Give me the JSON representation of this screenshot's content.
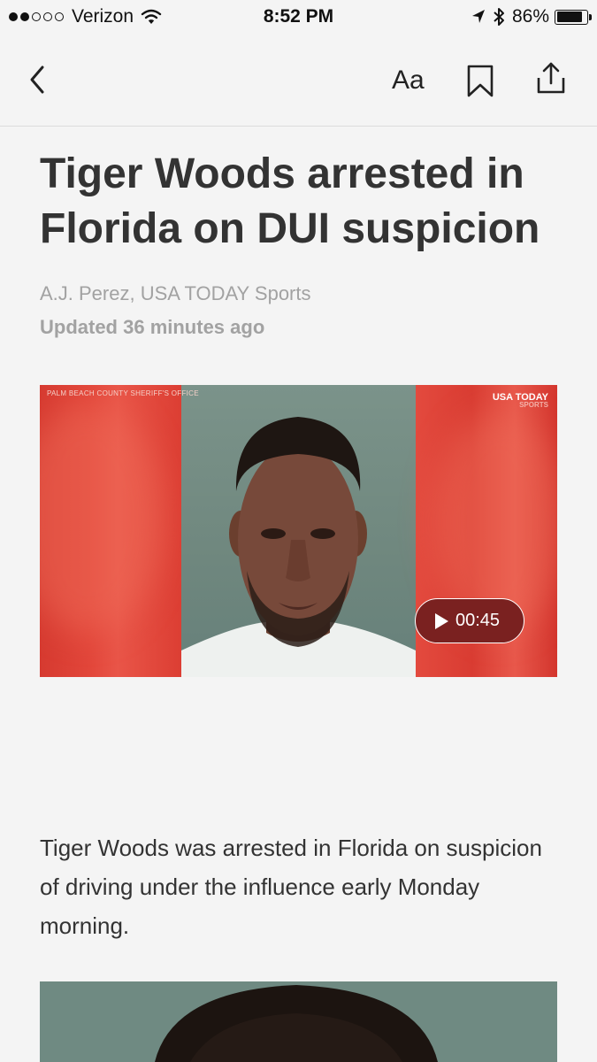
{
  "status_bar": {
    "carrier": "Verizon",
    "signal_bars_filled": 2,
    "signal_bars_total": 5,
    "time": "8:52 PM",
    "battery": "86%",
    "battery_level": 0.86
  },
  "nav": {
    "font_size_label": "Aa"
  },
  "article": {
    "headline": "Tiger Woods arrested in Florida on DUI suspicion",
    "byline": "A.J. Perez, USA TODAY Sports",
    "updated": "Updated 36 minutes ago",
    "video": {
      "credit": "PALM BEACH COUNTY SHERIFF'S OFFICE",
      "brand": "USA TODAY",
      "brand_sub": "SPORTS",
      "duration": "00:45"
    },
    "body": "Tiger Woods was arrested in Florida on suspicion of driving under the influence early Monday morning."
  },
  "colors": {
    "background": "#f4f4f4",
    "headline": "#333333",
    "meta": "#a2a2a2",
    "video_red": "#d4322d"
  }
}
